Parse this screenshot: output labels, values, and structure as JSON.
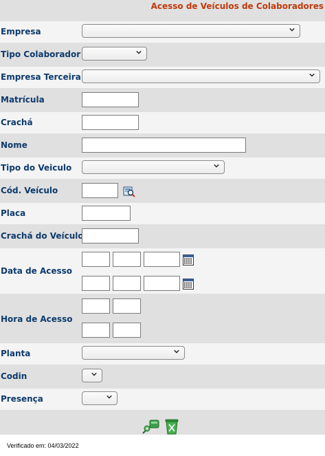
{
  "header": {
    "title": "Acesso de Veículos de Colaboradores"
  },
  "form": {
    "empresa_label": "Empresa",
    "tipo_colaborador_label": "Tipo Colaborador",
    "empresa_terceira_label": "Empresa Terceira",
    "matricula_label": "Matrícula",
    "cracha_label": "Crachá",
    "nome_label": "Nome",
    "tipo_veiculo_label": "Tipo do Veiculo",
    "cod_veiculo_label": "Cód. Veículo",
    "placa_label": "Placa",
    "cracha_veiculo_label": "Crachá do Veículo",
    "data_acesso_label": "Data de Acesso",
    "hora_acesso_label": "Hora de Acesso",
    "planta_label": "Planta",
    "codin_label": "Codin",
    "presenca_label": "Presença"
  },
  "icons": {
    "search_vehicle": "search-vehicle-icon",
    "calendar": "calendar-icon",
    "confirm": "confirm-icon",
    "clear": "trash-icon"
  },
  "colors": {
    "title": "#c0390b",
    "label": "#0d3a6b",
    "panel": "#e0e0e0",
    "row_light": "#f4f4f4"
  },
  "footer": {
    "verified_text": "Verificado em: 04/03/2022"
  }
}
